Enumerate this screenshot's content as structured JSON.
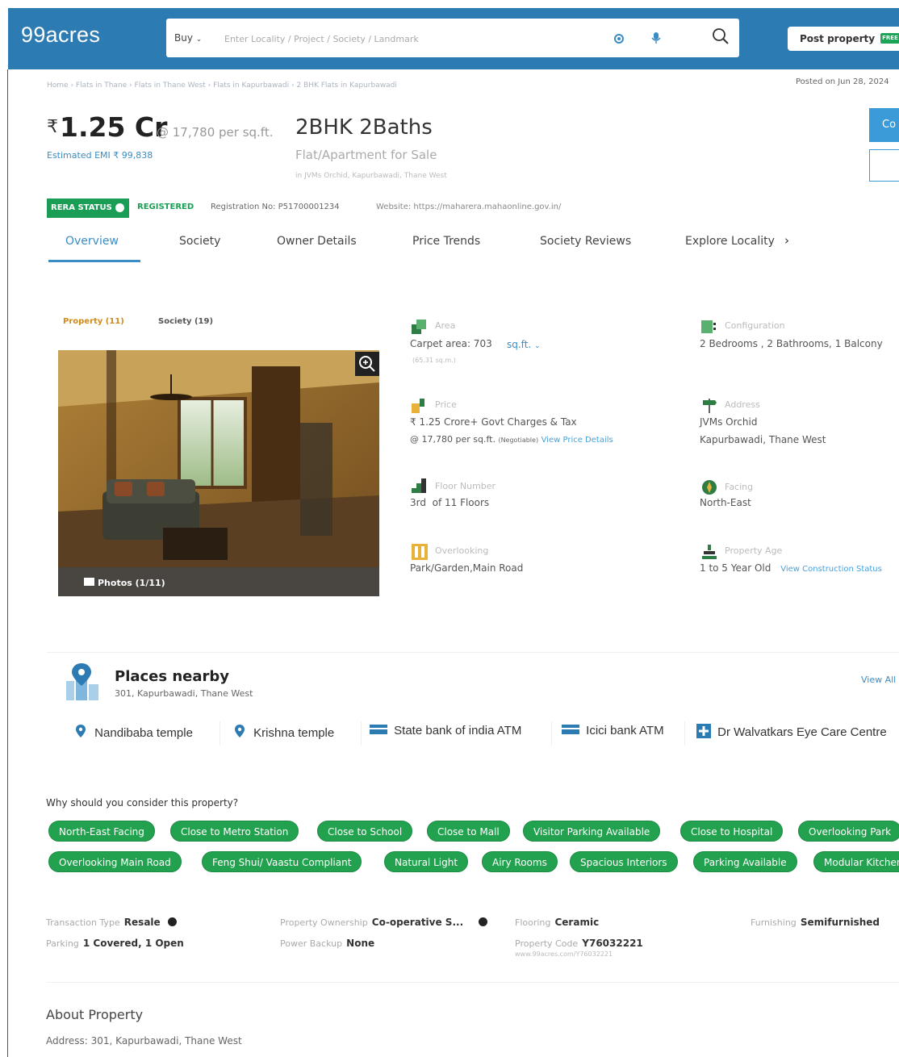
{
  "header": {
    "logo": "99acres",
    "buy_label": "Buy",
    "search_placeholder": "Enter Locality / Project / Society / Landmark",
    "post_property_label": "Post property",
    "free_badge": "FREE"
  },
  "breadcrumb": "Home › Flats in Thane › Flats in Thane West › Flats in Kapurbawadi › 2 BHK Flats in Kapurbawadi",
  "posted_on": "Posted on Jun 28, 2024",
  "listing": {
    "rupee": "₹",
    "price": "1.25 Cr",
    "price_per_sqft": "@ 17,780 per sq.ft.",
    "emi": "Estimated EMI ₹ 99,838",
    "title": "2BHK 2Baths",
    "subtitle": "Flat/Apartment for Sale",
    "location": "in JVMs Orchid, Kapurbawadi, Thane West",
    "contact_label": "Co"
  },
  "rera": {
    "status_label": "RERA STATUS",
    "registered_label": "REGISTERED",
    "registration": "Registration No: P51700001234",
    "website": "Website: https://maharera.mahaonline.gov.in/"
  },
  "tabs": [
    "Overview",
    "Society",
    "Owner Details",
    "Price Trends",
    "Society Reviews",
    "Explore Locality"
  ],
  "gallery": {
    "tab_property": "Property (11)",
    "tab_society": "Society (19)",
    "photos_label": "Photos (1/11)"
  },
  "details": {
    "area": {
      "label": "Area",
      "value": "Carpet area: 703",
      "unit": "sq.ft.",
      "sub": "(65.31 sq.m.)"
    },
    "configuration": {
      "label": "Configuration",
      "value": "2 Bedrooms , 2 Bathrooms, 1 Balcony"
    },
    "price": {
      "label": "Price",
      "value": "₹ 1.25 Crore+ Govt Charges & Tax",
      "sub": "@ 17,780 per sq.ft.",
      "negotiable": "(Negotiable)",
      "link": "View Price Details"
    },
    "address": {
      "label": "Address",
      "line1": "JVMs Orchid",
      "line2": "Kapurbawadi, Thane West"
    },
    "floor": {
      "label": "Floor Number",
      "value": "3rd  of 11 Floors"
    },
    "facing": {
      "label": "Facing",
      "value": "North-East"
    },
    "overlooking": {
      "label": "Overlooking",
      "value": "Park/Garden,Main Road"
    },
    "age": {
      "label": "Property Age",
      "value": "1 to 5 Year Old",
      "link": "View Construction Status"
    }
  },
  "places": {
    "title": "Places nearby",
    "address": "301, Kapurbawadi, Thane West",
    "view_all": "View All",
    "items": [
      {
        "name": "Nandibaba temple",
        "icon": "location-pin-icon"
      },
      {
        "name": "Krishna temple",
        "icon": "location-pin-icon"
      },
      {
        "name": "State bank of india ATM",
        "icon": "atm-icon"
      },
      {
        "name": "Icici bank ATM",
        "icon": "atm-icon"
      },
      {
        "name": "Dr Walvatkars Eye Care Centre",
        "icon": "hospital-icon"
      }
    ]
  },
  "why": {
    "title": "Why should you consider this property?",
    "row1": [
      "North-East Facing",
      "Close to Metro Station",
      "Close to School",
      "Close to Mall",
      "Visitor Parking Available",
      "Close to Hospital",
      "Overlooking Park"
    ],
    "row2": [
      "Overlooking Main Road",
      "Feng Shui/ Vaastu Compliant",
      "Natural Light",
      "Airy Rooms",
      "Spacious Interiors",
      "Parking Available",
      "Modular Kitchen"
    ]
  },
  "info": {
    "transaction_type": {
      "label": "Transaction Type",
      "value": "Resale"
    },
    "ownership": {
      "label": "Property Ownership",
      "value": "Co-operative S..."
    },
    "flooring": {
      "label": "Flooring",
      "value": "Ceramic"
    },
    "furnishing": {
      "label": "Furnishing",
      "value": "Semifurnished"
    },
    "parking": {
      "label": "Parking",
      "value": "1 Covered, 1 Open"
    },
    "power_backup": {
      "label": "Power Backup",
      "value": "None"
    },
    "property_code": {
      "label": "Property Code",
      "value": "Y76032221",
      "url": "www.99acres.com/Y76032221"
    }
  },
  "about": {
    "title": "About Property",
    "address": "Address: 301, Kapurbawadi, Thane West"
  },
  "colors": {
    "header_blue": "#2d7bb3",
    "accent_blue": "#3a8cc4",
    "green": "#22a24e",
    "orange": "#d08b18"
  }
}
